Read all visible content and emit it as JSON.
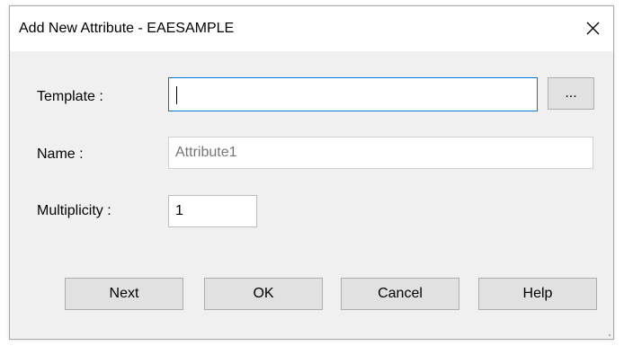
{
  "window": {
    "title": "Add New Attribute - EAESAMPLE",
    "close_icon": "close-icon"
  },
  "form": {
    "template_label": "Template :",
    "template_value": "",
    "browse_label": "...",
    "name_label": "Name :",
    "name_placeholder": "Attribute1",
    "multiplicity_label": "Multiplicity :",
    "multiplicity_value": "1"
  },
  "buttons": {
    "next": "Next",
    "ok": "OK",
    "cancel": "Cancel",
    "help": "Help"
  },
  "colors": {
    "focus_border": "#0078d7",
    "dialog_background": "#f0f0f0",
    "button_background": "#e1e1e1"
  }
}
